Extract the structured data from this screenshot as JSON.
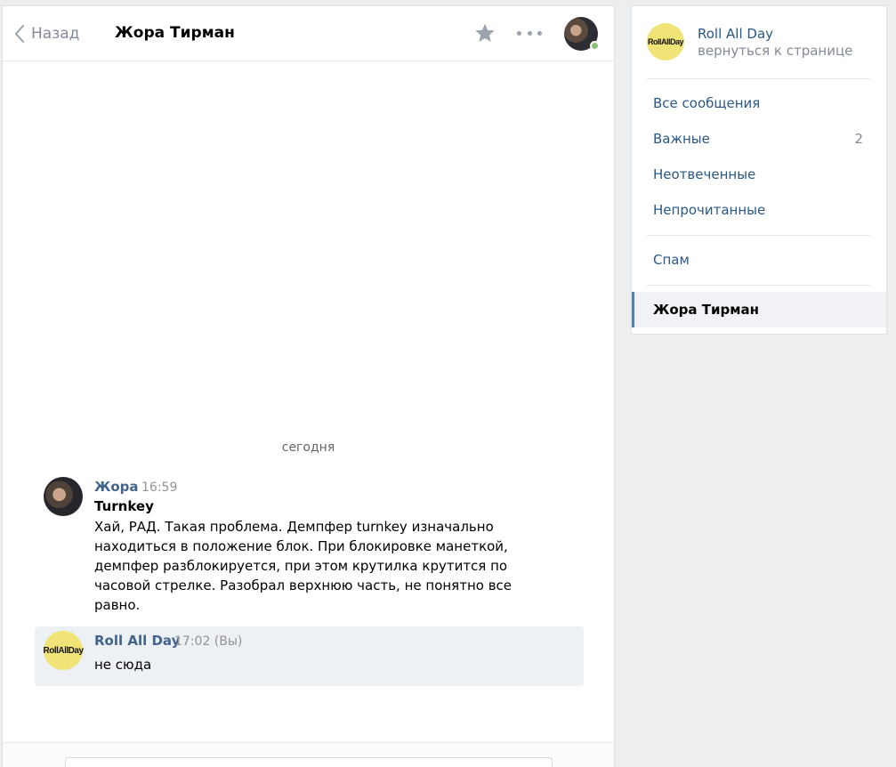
{
  "header": {
    "back_label": "Назад",
    "peer_name": "Жора Тирман",
    "icons": [
      "chevron-left-icon",
      "star-icon",
      "more-icon"
    ]
  },
  "conversation": {
    "date_separator": "сегодня",
    "messages": [
      {
        "author": "Жора",
        "time": "16:59",
        "subject": "Turnkey",
        "text": "Хай, РАД. Такая проблема. Демпфер turnkey изначально находиться в положение блок. При блокировке манеткой, демпфер разблокируется, при этом крутилка крутится по часовой стрелке. Разобрал верхнюю часть, не понятно все равно."
      },
      {
        "author": "Roll All Day",
        "time": "17:02 (Вы)",
        "text": "не сюда",
        "avatar_label": "RollAllDay"
      }
    ]
  },
  "sidebar": {
    "community_name": "Roll All Day",
    "community_back": "вернуться к странице",
    "community_avatar_label": "RollAllDay",
    "items": [
      {
        "label": "Все сообщения"
      },
      {
        "label": "Важные",
        "count": "2"
      },
      {
        "label": "Неотвеченные"
      },
      {
        "label": "Непрочитанные"
      },
      {
        "label": "Спам"
      },
      {
        "label": "Жора Тирман",
        "active": true
      }
    ]
  },
  "colors": {
    "link": "#2a5885",
    "author": "#42648b",
    "accent": "#5181b8",
    "online": "#8ac176",
    "background": "#edeef0"
  }
}
